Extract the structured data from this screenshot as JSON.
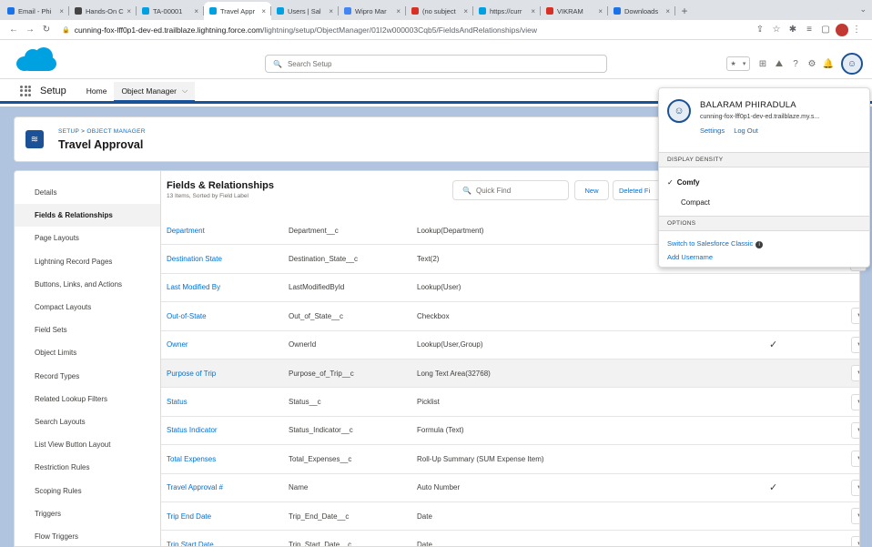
{
  "browser": {
    "tabs": [
      {
        "title": "Email - Phi",
        "color": "#1a73e8"
      },
      {
        "title": "Hands-On C",
        "color": "#444"
      },
      {
        "title": "TA-00001",
        "color": "#00a1e0"
      },
      {
        "title": "Travel Appr",
        "color": "#00a1e0"
      },
      {
        "title": "Users | Sal",
        "color": "#00a1e0"
      },
      {
        "title": "Wipro Mar",
        "color": "#4285f4"
      },
      {
        "title": "(no subject",
        "color": "#d93025"
      },
      {
        "title": "https://curr",
        "color": "#00a1e0"
      },
      {
        "title": "VIKRAM",
        "color": "#d93025"
      },
      {
        "title": "Downloads",
        "color": "#1a73e8"
      }
    ],
    "url_host": "cunning-fox-lff0p1-dev-ed.trailblaze.lightning.force.com",
    "url_path": "/lightning/setup/ObjectManager/01I2w000003Cqb5/FieldsAndRelationships/view"
  },
  "header": {
    "search_placeholder": "Search Setup"
  },
  "context": {
    "app_name": "Setup",
    "nav_home": "Home",
    "nav_object_manager": "Object Manager"
  },
  "object": {
    "breadcrumb_setup": "SETUP",
    "breadcrumb_sep": " > ",
    "breadcrumb_om": "OBJECT MANAGER",
    "title": "Travel Approval"
  },
  "sidebar": {
    "items": [
      "Details",
      "Fields & Relationships",
      "Page Layouts",
      "Lightning Record Pages",
      "Buttons, Links, and Actions",
      "Compact Layouts",
      "Field Sets",
      "Object Limits",
      "Record Types",
      "Related Lookup Filters",
      "Search Layouts",
      "List View Button Layout",
      "Restriction Rules",
      "Scoping Rules",
      "Triggers",
      "Flow Triggers"
    ],
    "active_index": 1
  },
  "list": {
    "title": "Fields & Relationships",
    "subtitle": "13 Items, Sorted by Field Label",
    "quick_find_placeholder": "Quick Find",
    "new_button": "New",
    "deleted_button": "Deleted Fi",
    "rows": [
      {
        "label": "Department",
        "api": "Department__c",
        "type": "Lookup(Department)",
        "indexed": ""
      },
      {
        "label": "Destination State",
        "api": "Destination_State__c",
        "type": "Text(2)",
        "indexed": ""
      },
      {
        "label": "Last Modified By",
        "api": "LastModifiedById",
        "type": "Lookup(User)",
        "indexed": ""
      },
      {
        "label": "Out-of-State",
        "api": "Out_of_State__c",
        "type": "Checkbox",
        "indexed": ""
      },
      {
        "label": "Owner",
        "api": "OwnerId",
        "type": "Lookup(User,Group)",
        "indexed": "✓"
      },
      {
        "label": "Purpose of Trip",
        "api": "Purpose_of_Trip__c",
        "type": "Long Text Area(32768)",
        "indexed": ""
      },
      {
        "label": "Status",
        "api": "Status__c",
        "type": "Picklist",
        "indexed": ""
      },
      {
        "label": "Status Indicator",
        "api": "Status_Indicator__c",
        "type": "Formula (Text)",
        "indexed": ""
      },
      {
        "label": "Total Expenses",
        "api": "Total_Expenses__c",
        "type": "Roll-Up Summary (SUM Expense Item)",
        "indexed": ""
      },
      {
        "label": "Travel Approval #",
        "api": "Name",
        "type": "Auto Number",
        "indexed": "✓"
      },
      {
        "label": "Trip End Date",
        "api": "Trip_End_Date__c",
        "type": "Date",
        "indexed": ""
      },
      {
        "label": "Trip Start Date",
        "api": "Trip_Start_Date__c",
        "type": "Date",
        "indexed": ""
      }
    ]
  },
  "profile_menu": {
    "name": "BALARAM PHIRADULA",
    "org": "cunning-fox-lff0p1-dev-ed.trailblaze.my.s...",
    "settings": "Settings",
    "logout": "Log Out",
    "density_header": "DISPLAY DENSITY",
    "comfy": "Comfy",
    "compact": "Compact",
    "options_header": "OPTIONS",
    "switch_classic": "Switch to Salesforce Classic",
    "add_username": "Add Username"
  },
  "colors": {
    "brand": "#1b5297",
    "link": "#0070d2",
    "page_bg": "#b0c4df"
  }
}
